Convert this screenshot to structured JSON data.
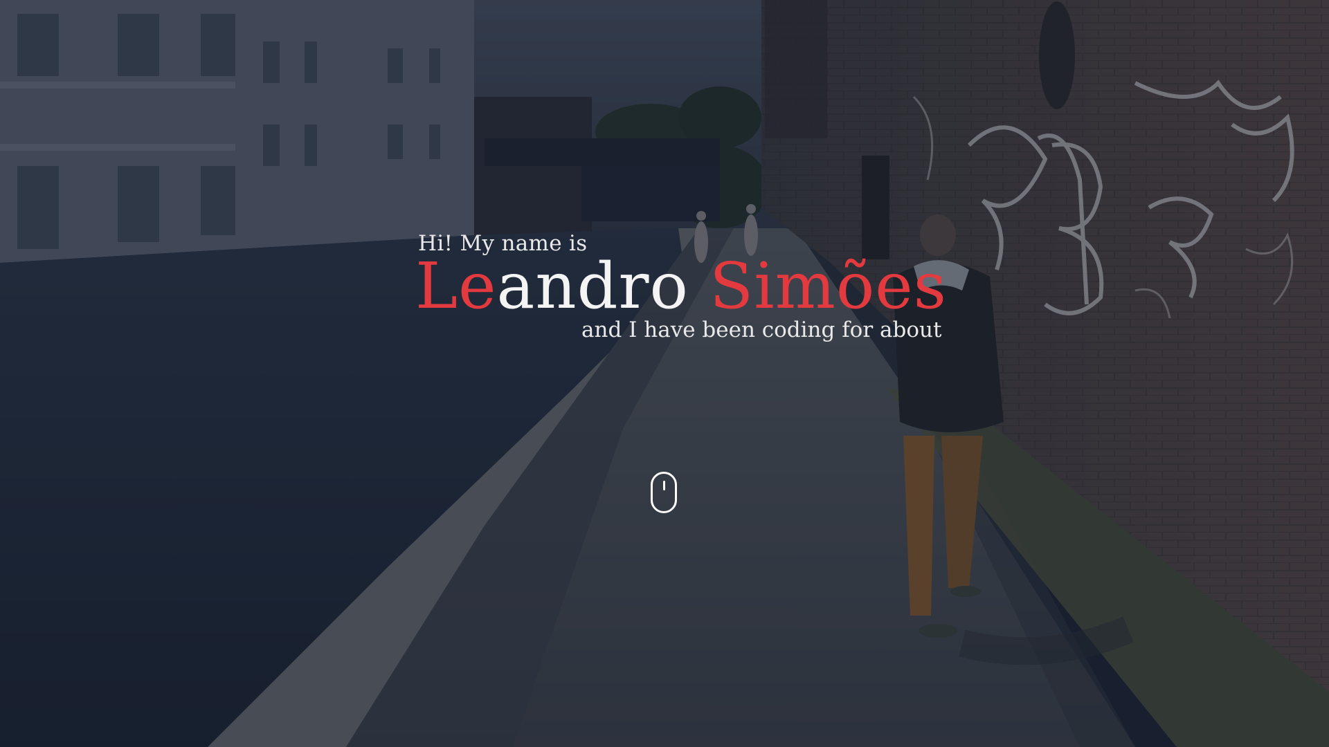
{
  "hero": {
    "greeting": "Hi! My name is",
    "name_parts": {
      "first_accent": "Le",
      "first_rest": "andro",
      "space": " ",
      "last": "Simões"
    },
    "tagline": "and I have been coding for about"
  },
  "icons": {
    "scroll": "mouse-scroll-icon"
  },
  "colors": {
    "accent": "#e23a3f",
    "text": "#f4f4f4",
    "overlay": "#161e2e"
  }
}
